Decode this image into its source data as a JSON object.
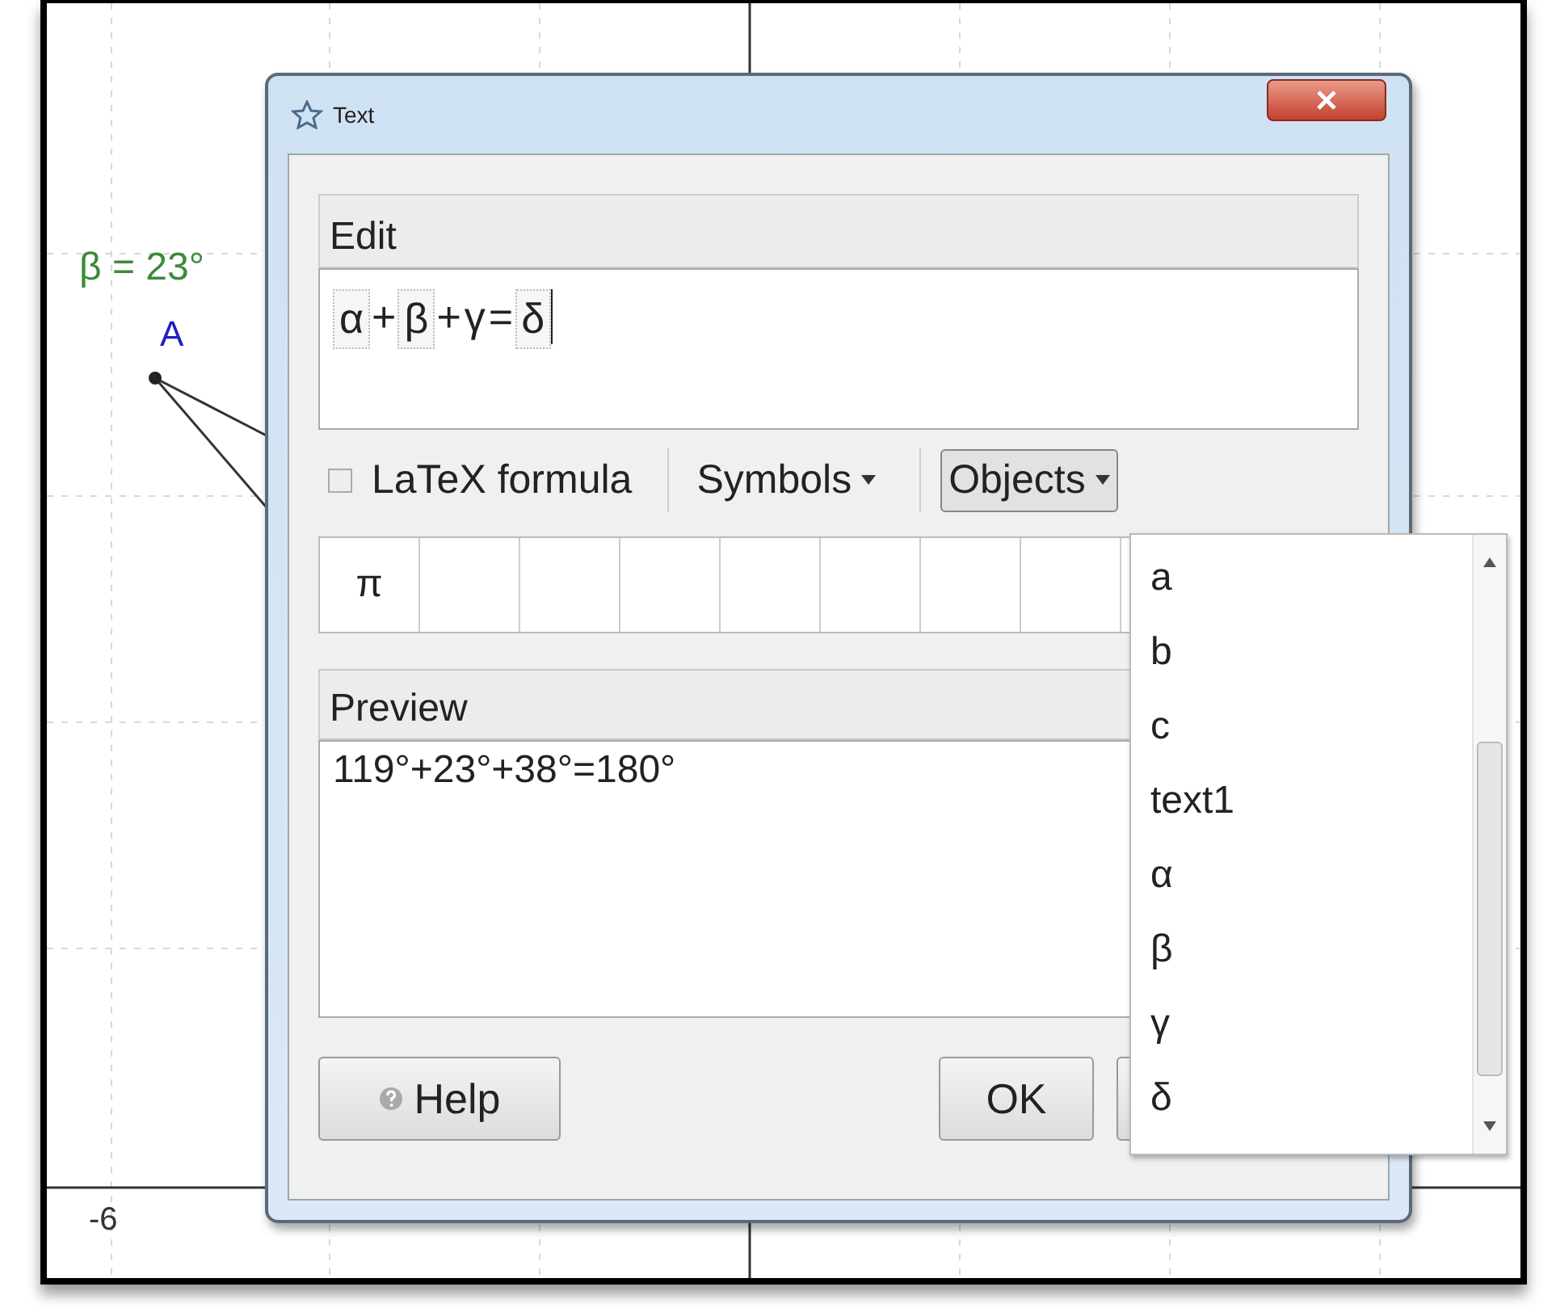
{
  "graph": {
    "x_axis_labels": [
      "-6"
    ],
    "angle_label": "β = 23°",
    "point_label": "A"
  },
  "dialog": {
    "title": "Text",
    "edit": {
      "label": "Edit",
      "tokens": [
        {
          "text": "α",
          "kind": "object"
        },
        {
          "text": "+",
          "kind": "operator"
        },
        {
          "text": "β",
          "kind": "object"
        },
        {
          "text": "+",
          "kind": "operator"
        },
        {
          "text": "γ",
          "kind": "operator"
        },
        {
          "text": "=",
          "kind": "operator"
        },
        {
          "text": "δ",
          "kind": "object"
        }
      ]
    },
    "latex": {
      "label": "LaTeX formula",
      "checked": false
    },
    "menus": [
      {
        "label": "Symbols",
        "expanded": false
      },
      {
        "label": "Objects",
        "expanded": true
      }
    ],
    "symbols": [
      "π"
    ],
    "preview": {
      "label": "Preview",
      "text": "119°+23°+38°=180°"
    },
    "buttons": [
      {
        "label": "Help",
        "kind": "help"
      },
      {
        "label": "OK",
        "kind": "ok"
      }
    ]
  },
  "objects_menu": {
    "items": [
      "a",
      "b",
      "c",
      "text1",
      "α",
      "β",
      "γ",
      "δ"
    ]
  }
}
